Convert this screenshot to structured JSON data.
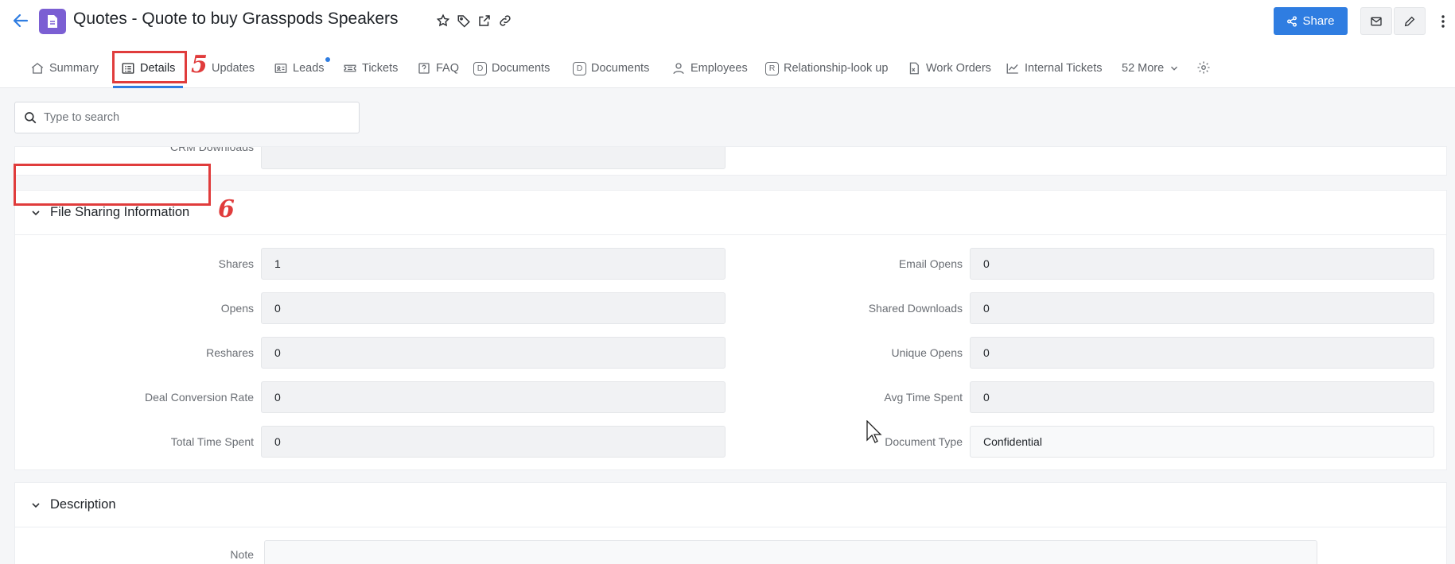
{
  "header": {
    "title": "Quotes - Quote to buy Grasspods Speakers",
    "share_label": "Share"
  },
  "tabs": [
    {
      "label": "Summary",
      "icon": "home-icon"
    },
    {
      "label": "Details",
      "icon": "list-icon"
    },
    {
      "label": "Updates",
      "icon": ""
    },
    {
      "label": "Leads",
      "icon": "id-card-icon"
    },
    {
      "label": "Tickets",
      "icon": "ticket-icon"
    },
    {
      "label": "FAQ",
      "icon": "question-box-icon"
    },
    {
      "label": "Documents",
      "icon": "letter-d-icon",
      "letter": "D"
    },
    {
      "label": "Documents",
      "icon": "letter-d-icon",
      "letter": "D"
    },
    {
      "label": "Employees",
      "icon": "person-icon"
    },
    {
      "label": "Relationship-look up",
      "icon": "letter-r-icon",
      "letter": "R"
    },
    {
      "label": "Work Orders",
      "icon": "spreadsheet-icon"
    },
    {
      "label": "Internal Tickets",
      "icon": "chart-icon"
    },
    {
      "label": "52 More",
      "icon": "chevron-down-icon"
    }
  ],
  "annotations": {
    "details_tab": "5",
    "section_header": "6"
  },
  "search": {
    "placeholder": "Type to search"
  },
  "top_card": {
    "partial_label": "CRM Downloads"
  },
  "file_sharing": {
    "title": "File Sharing Information",
    "left_fields": [
      {
        "label": "Shares",
        "value": "1"
      },
      {
        "label": "Opens",
        "value": "0"
      },
      {
        "label": "Reshares",
        "value": "0"
      },
      {
        "label": "Deal Conversion Rate",
        "value": "0"
      },
      {
        "label": "Total Time Spent",
        "value": "0"
      }
    ],
    "right_fields": [
      {
        "label": "Email Opens",
        "value": "0"
      },
      {
        "label": "Shared Downloads",
        "value": "0"
      },
      {
        "label": "Unique Opens",
        "value": "0"
      },
      {
        "label": "Avg Time Spent",
        "value": "0"
      },
      {
        "label": "Document Type",
        "value": "Confidential"
      }
    ]
  },
  "description": {
    "title": "Description",
    "note_label": "Note"
  },
  "colors": {
    "accent": "#2f7de1",
    "badge": "#7b5fd3",
    "annotation": "#e03c3c"
  }
}
